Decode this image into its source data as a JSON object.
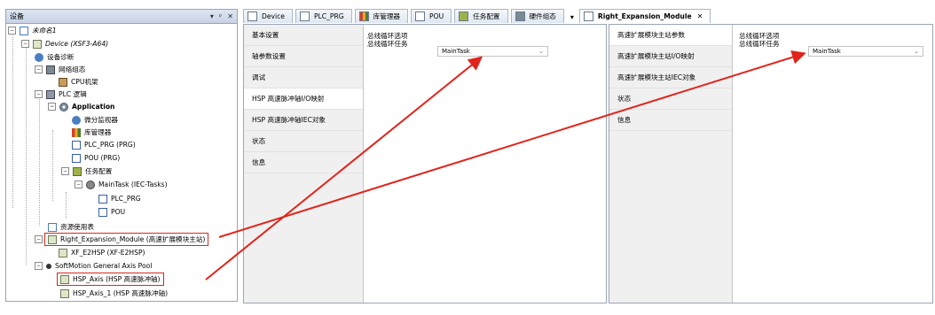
{
  "left_panel": {
    "title": "设备",
    "controls": [
      "▾",
      "ᵖ",
      "✕"
    ],
    "tree": [
      {
        "label": "未命名1",
        "expander": "−"
      },
      {
        "label": "Device (XSF3-A64)",
        "expander": "−"
      },
      {
        "label": "设备诊断",
        "expander": ""
      },
      {
        "label": "网络组态",
        "expander": "−"
      },
      {
        "label": "CPU机架",
        "expander": ""
      },
      {
        "label": "PLC 逻辑",
        "expander": "−"
      },
      {
        "label": "Application",
        "expander": "−"
      },
      {
        "label": "微分监视器",
        "expander": ""
      },
      {
        "label": "库管理器",
        "expander": ""
      },
      {
        "label": "PLC_PRG (PRG)",
        "expander": ""
      },
      {
        "label": "POU (PRG)",
        "expander": ""
      },
      {
        "label": "任务配置",
        "expander": "−"
      },
      {
        "label": "MainTask (IEC-Tasks)",
        "expander": "−"
      },
      {
        "label": "PLC_PRG",
        "expander": ""
      },
      {
        "label": "POU",
        "expander": ""
      },
      {
        "label": "资源使用表",
        "expander": ""
      },
      {
        "label": "Right_Expansion_Module (高速扩展模块主站)",
        "expander": "−"
      },
      {
        "label": "XF_E2HSP (XF-E2HSP)",
        "expander": ""
      },
      {
        "label": "SoftMotion General Axis Pool",
        "expander": "−"
      },
      {
        "label": "HSP_Axis (HSP 高速脉冲轴)",
        "expander": ""
      },
      {
        "label": "HSP_Axis_1 (HSP 高速脉冲轴)",
        "expander": ""
      }
    ]
  },
  "tabs_main": [
    {
      "label": "Device",
      "icon": "device-icon"
    },
    {
      "label": "PLC_PRG",
      "icon": "pou-icon"
    },
    {
      "label": "库管理器",
      "icon": "library-icon"
    },
    {
      "label": "POU",
      "icon": "pou-icon"
    },
    {
      "label": "任务配置",
      "icon": "task-config-icon"
    },
    {
      "label": "硬件组态",
      "icon": "hardware-config-icon"
    }
  ],
  "tab_overflow": "▾",
  "tab_right": {
    "label": "Right_Expansion_Module",
    "close": "✕"
  },
  "axis_editor": {
    "nav": [
      "基本设置",
      "轴参数设置",
      "调试",
      "HSP 高速脉冲轴I/O映射",
      "HSP 高速脉冲轴IEC对象",
      "状态",
      "信息"
    ],
    "selected_index": 3,
    "section": "总线循环选项",
    "field_label": "总线循环任务",
    "field_value": "MainTask",
    "chevron": "⌄"
  },
  "module_editor": {
    "nav": [
      "高速扩展模块主站参数",
      "高速扩展模块主站I/O映射",
      "高速扩展模块主站IEC对象",
      "状态",
      "信息"
    ],
    "selected_index": 0,
    "section": "总线循环选项",
    "field_label": "总线循环任务",
    "field_value": "MainTask",
    "chevron": "⌄"
  },
  "colors": {
    "highlight": "#d12b20",
    "arrow": "#e0241b"
  }
}
